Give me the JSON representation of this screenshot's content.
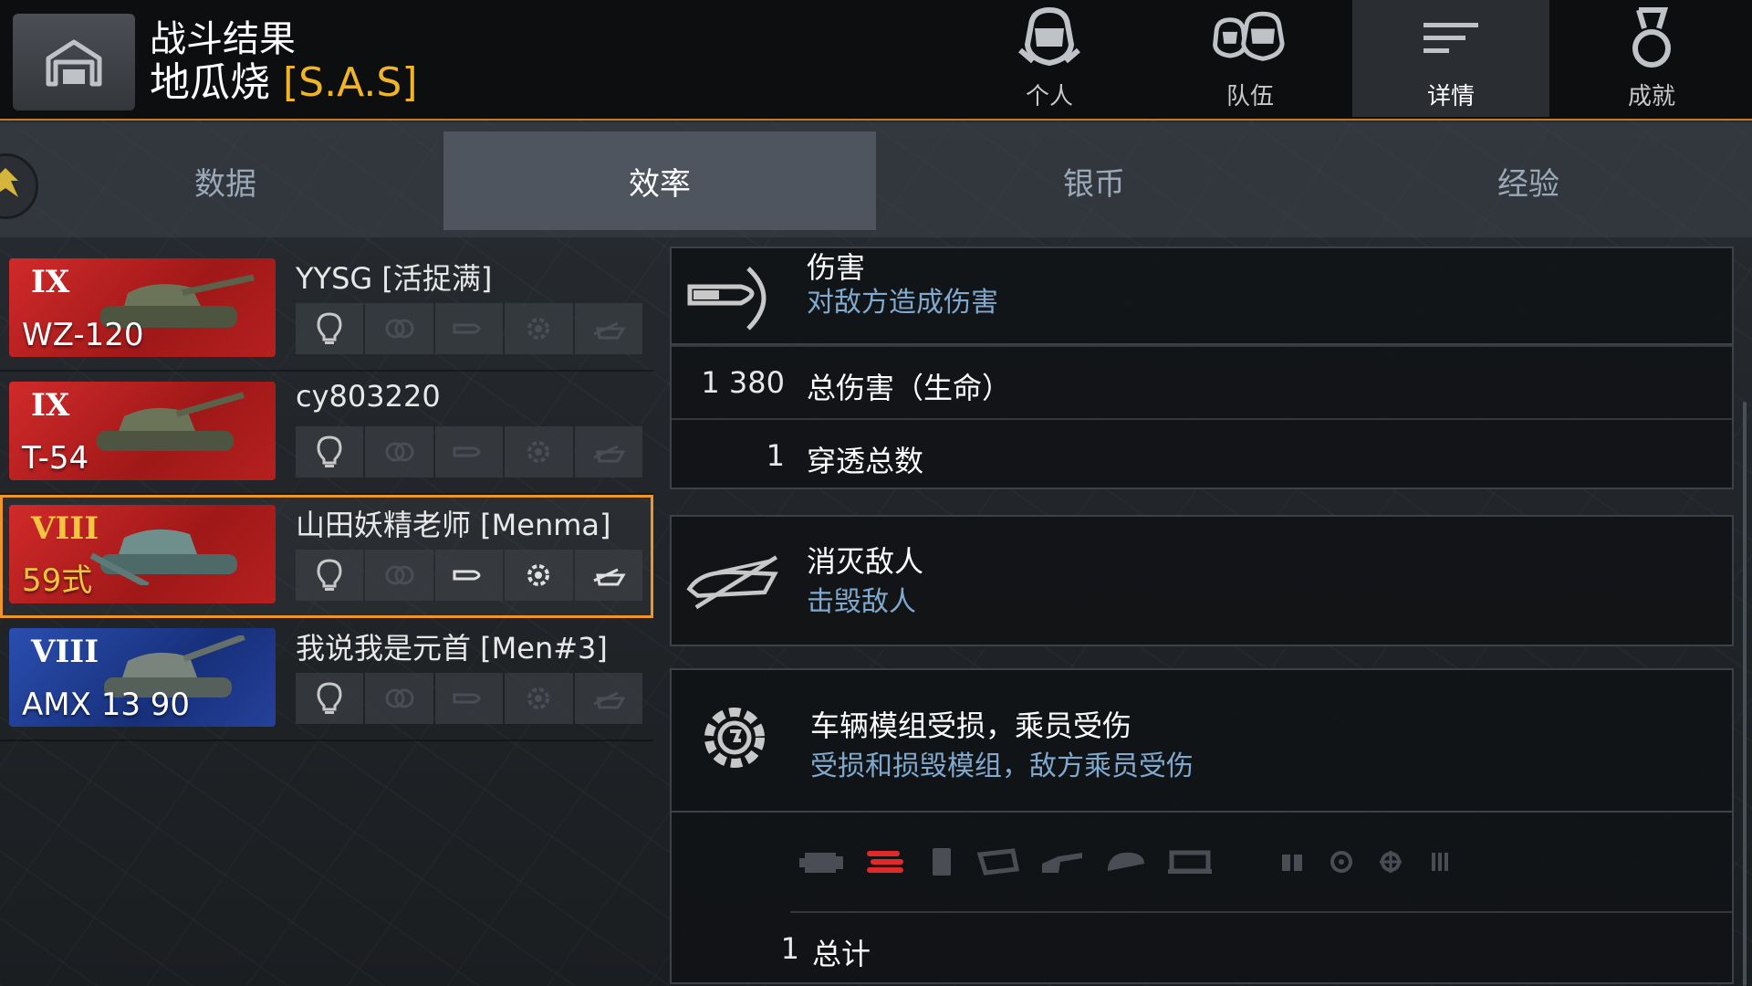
{
  "header": {
    "title": "战斗结果",
    "player_name": "地瓜烧",
    "player_clan": "[S.A.S]",
    "nav_tabs": [
      {
        "label": "个人",
        "icon": "personal-helmet-icon"
      },
      {
        "label": "队伍",
        "icon": "team-helmets-icon"
      },
      {
        "label": "详情",
        "icon": "details-lines-icon",
        "active": true
      },
      {
        "label": "成就",
        "icon": "medal-icon"
      }
    ]
  },
  "subtabs": [
    {
      "label": "数据"
    },
    {
      "label": "效率",
      "active": true
    },
    {
      "label": "银币"
    },
    {
      "label": "经验"
    }
  ],
  "players": [
    {
      "name": "YYSG [活捉满]",
      "tier": "IX",
      "tank": "WZ-120",
      "flag": "red",
      "premium": false
    },
    {
      "name": "cy803220",
      "tier": "IX",
      "tank": "T-54",
      "flag": "red",
      "premium": false
    },
    {
      "name": "山田妖精老师 [Menma]",
      "tier": "VIII",
      "tank": "59式",
      "flag": "red",
      "premium": true,
      "selected": true
    },
    {
      "name": "我说我是元首 [Men#3]",
      "tier": "VIII",
      "tank": "AMX 13 90",
      "flag": "blue",
      "premium": false
    }
  ],
  "sections": {
    "damage": {
      "title": "伤害",
      "desc": "对敌方造成伤害",
      "rows": [
        {
          "value": "1 380",
          "label": "总伤害（生命）"
        },
        {
          "value": "1",
          "label": "穿透总数"
        }
      ]
    },
    "kills": {
      "title": "消灭敌人",
      "desc": "击毁敌人"
    },
    "modules": {
      "title": "车辆模组受损，乘员受伤",
      "desc": "受损和损毁模组，敌方乘员受伤",
      "total_value": "1",
      "total_label": "总计"
    }
  },
  "colors": {
    "accent": "#f0952a",
    "clan": "#f0b429",
    "desc": "#7fa9cf",
    "damaged_module": "#e02a2a"
  }
}
